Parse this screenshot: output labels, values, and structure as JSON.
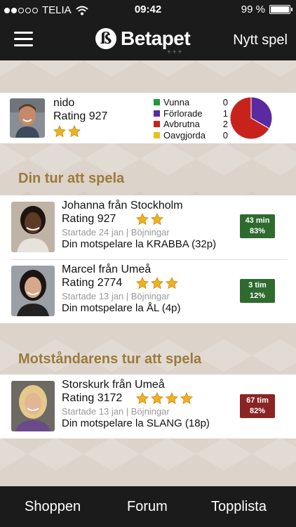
{
  "status_bar": {
    "carrier": "TELIA",
    "time": "09:42",
    "battery": "99 %",
    "battery_level": 0.99,
    "signal_bars": 2
  },
  "navbar": {
    "menu_icon": "hamburger-menu-icon",
    "logo_letter": "ß",
    "logo_text": "Betapet",
    "logo_sub": "+++",
    "new_game_label": "Nytt spel"
  },
  "player": {
    "name": "nido",
    "rating": "Rating 927",
    "stars": 2,
    "stats": [
      {
        "label": "Vunna",
        "value": "0",
        "color": "#1e9a3c"
      },
      {
        "label": "Förlorade",
        "value": "1",
        "color": "#5a2aa0"
      },
      {
        "label": "Avbrutna",
        "value": "2",
        "color": "#c8231b"
      },
      {
        "label": "Oavgjorda",
        "value": "0",
        "color": "#e8c020"
      }
    ]
  },
  "sections": {
    "your_turn": "Din tur att spela",
    "opponent_turn": "Motståndarens tur att spela"
  },
  "your_turn_games": [
    {
      "name": "Johanna från Stockholm",
      "rating": "Rating 927",
      "stars": 2,
      "meta": "Startade 24 jan | Böjningar",
      "message": "Din motspelare la KRABBA (32p)",
      "time": "43 min",
      "percent": "83%",
      "badge_color": "#2f6b2f"
    },
    {
      "name": "Marcel från Umeå",
      "rating": "Rating 2774",
      "stars": 3,
      "meta": "Startade 13 jan | Böjningar",
      "message": "Din motspelare la ÅL (4p)",
      "time": "3 tim",
      "percent": "12%",
      "badge_color": "#2f6b2f"
    }
  ],
  "opponent_turn_games": [
    {
      "name": "Storskurk från Umeå",
      "rating": "Rating 3172",
      "stars": 4,
      "meta": "Startade 13 jan | Böjningar",
      "message": "Din motspelare la SLANG (18p)",
      "time": "67 tim",
      "percent": "82%",
      "badge_color": "#8b2424"
    }
  ],
  "tabbar": {
    "shop": "Shoppen",
    "forum": "Forum",
    "toplist": "Topplista"
  }
}
